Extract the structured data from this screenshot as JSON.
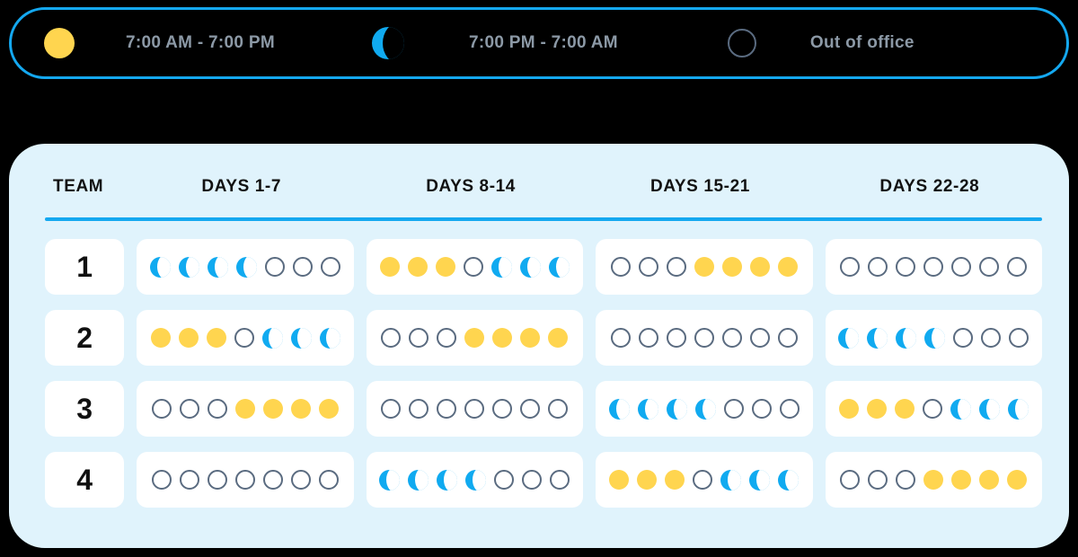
{
  "legend": {
    "items": [
      {
        "icon": "sun-icon",
        "shift": "day",
        "label": "7:00 AM - 7:00 PM"
      },
      {
        "icon": "moon-icon",
        "shift": "night",
        "label": "7:00 PM - 7:00 AM"
      },
      {
        "icon": "empty-circle-icon",
        "shift": "off",
        "label": "Out of office"
      }
    ]
  },
  "schedule": {
    "headers": {
      "team": "TEAM",
      "weeks": [
        "DAYS 1-7",
        "DAYS 8-14",
        "DAYS 15-21",
        "DAYS 22-28"
      ]
    },
    "rows": [
      {
        "team": "1",
        "weeks": [
          [
            "night",
            "night",
            "night",
            "night",
            "off",
            "off",
            "off"
          ],
          [
            "day",
            "day",
            "day",
            "off",
            "night",
            "night",
            "night"
          ],
          [
            "off",
            "off",
            "off",
            "day",
            "day",
            "day",
            "day"
          ],
          [
            "off",
            "off",
            "off",
            "off",
            "off",
            "off",
            "off"
          ]
        ]
      },
      {
        "team": "2",
        "weeks": [
          [
            "day",
            "day",
            "day",
            "off",
            "night",
            "night",
            "night"
          ],
          [
            "off",
            "off",
            "off",
            "day",
            "day",
            "day",
            "day"
          ],
          [
            "off",
            "off",
            "off",
            "off",
            "off",
            "off",
            "off"
          ],
          [
            "night",
            "night",
            "night",
            "night",
            "off",
            "off",
            "off"
          ]
        ]
      },
      {
        "team": "3",
        "weeks": [
          [
            "off",
            "off",
            "off",
            "day",
            "day",
            "day",
            "day"
          ],
          [
            "off",
            "off",
            "off",
            "off",
            "off",
            "off",
            "off"
          ],
          [
            "night",
            "night",
            "night",
            "night",
            "off",
            "off",
            "off"
          ],
          [
            "day",
            "day",
            "day",
            "off",
            "night",
            "night",
            "night"
          ]
        ]
      },
      {
        "team": "4",
        "weeks": [
          [
            "off",
            "off",
            "off",
            "off",
            "off",
            "off",
            "off"
          ],
          [
            "night",
            "night",
            "night",
            "night",
            "off",
            "off",
            "off"
          ],
          [
            "day",
            "day",
            "day",
            "off",
            "night",
            "night",
            "night"
          ],
          [
            "off",
            "off",
            "off",
            "day",
            "day",
            "day",
            "day"
          ]
        ]
      }
    ]
  },
  "colors": {
    "page_background": "#000000",
    "panel_background": "#E0F3FC",
    "accent_blue": "#14A8F0",
    "shift_day": "#FFD54F",
    "shift_night": "#10AAF0",
    "shift_off_outline": "#5A6B80",
    "legend_text": "#8C99A6",
    "cell_background": "#FFFFFF"
  }
}
